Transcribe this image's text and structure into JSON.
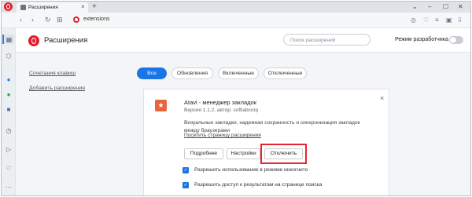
{
  "browser": {
    "tab_title": "Расширения",
    "tab_close": "×",
    "new_tab": "+",
    "url": "extensions",
    "window_buttons": [
      "⌄",
      "–",
      "☐",
      "✕"
    ]
  },
  "header": {
    "title": "Расширения",
    "search_placeholder": "Поиск расширений",
    "dev_mode_label": "Режим разработчика",
    "dev_mode_on": false
  },
  "side_links": {
    "shortcuts": "Сочетания клавиш",
    "add_extensions": "Добавить расширения"
  },
  "filters": [
    "Все",
    "Обновления",
    "Включенные",
    "Отключенные"
  ],
  "active_filter": "Все",
  "extension": {
    "name": "Atavi - менеджер закладок",
    "version": "Версия 1.1.2, автор: softlabcorp",
    "description": "Визуальные закладки, надежная сохранность и синхронизация закладок между браузерами",
    "site_link": "Посетить страницу расширения",
    "close": "×",
    "buttons": {
      "details": "Подробнее",
      "settings": "Настройки",
      "disable": "Отключить"
    },
    "options": [
      {
        "label": "Разрешить использование в режиме инкогнито",
        "checked": true
      },
      {
        "label": "Разрешить доступ к результатам на странице поиска",
        "checked": true
      }
    ]
  },
  "colors": {
    "accent": "#1976e4",
    "opera_red": "#e51d2a",
    "highlight": "#e5262d"
  }
}
